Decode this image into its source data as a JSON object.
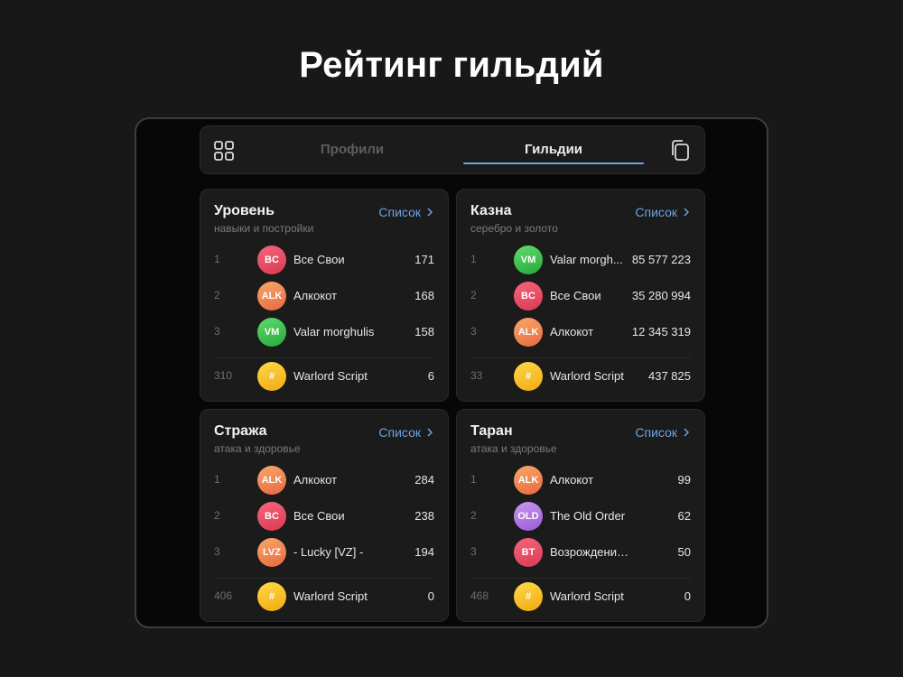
{
  "page": {
    "title": "Рейтинг гильдий"
  },
  "tabs": [
    {
      "label": "Профили",
      "active": false
    },
    {
      "label": "Гильдии",
      "active": true
    }
  ],
  "icons": {
    "menu": "grid-icon",
    "copy": "copy-icon",
    "chevron": "chevron-right-icon"
  },
  "colors": {
    "accent": "#6ea3e0"
  },
  "cards": [
    {
      "title": "Уровень",
      "subtitle": "навыки и постройки",
      "link": "Список",
      "rows": [
        {
          "rank": "1",
          "avatar": "BC",
          "name": "Все Свои",
          "value": "171"
        },
        {
          "rank": "2",
          "avatar": "ALK",
          "name": "Алкокот",
          "value": "168"
        },
        {
          "rank": "3",
          "avatar": "VM",
          "name": "Valar morghulis",
          "value": "158"
        }
      ],
      "own": {
        "rank": "310",
        "avatar": "#",
        "name": "Warlord Script",
        "value": "6"
      }
    },
    {
      "title": "Казна",
      "subtitle": "серебро и золото",
      "link": "Список",
      "rows": [
        {
          "rank": "1",
          "avatar": "VM",
          "name": "Valar morgh...",
          "value": "85 577 223"
        },
        {
          "rank": "2",
          "avatar": "BC",
          "name": "Все Свои",
          "value": "35 280 994"
        },
        {
          "rank": "3",
          "avatar": "ALK",
          "name": "Алкокот",
          "value": "12 345 319"
        }
      ],
      "own": {
        "rank": "33",
        "avatar": "#",
        "name": "Warlord Script",
        "value": "437 825"
      }
    },
    {
      "title": "Стража",
      "subtitle": "атака и здоровье",
      "link": "Список",
      "rows": [
        {
          "rank": "1",
          "avatar": "ALK",
          "name": "Алкокот",
          "value": "284"
        },
        {
          "rank": "2",
          "avatar": "BC",
          "name": "Все Свои",
          "value": "238"
        },
        {
          "rank": "3",
          "avatar": "LVZ",
          "name": "- Lucky [VZ] -",
          "value": "194"
        }
      ],
      "own": {
        "rank": "406",
        "avatar": "#",
        "name": "Warlord Script",
        "value": "0"
      }
    },
    {
      "title": "Таран",
      "subtitle": "атака и здоровье",
      "link": "Список",
      "rows": [
        {
          "rank": "1",
          "avatar": "ALK",
          "name": "Алкокот",
          "value": "99"
        },
        {
          "rank": "2",
          "avatar": "OLD",
          "name": "The Old Order",
          "value": "62"
        },
        {
          "rank": "3",
          "avatar": "BT",
          "name": "Возрождение тьмы",
          "value": "50"
        }
      ],
      "own": {
        "rank": "468",
        "avatar": "#",
        "name": "Warlord Script",
        "value": "0"
      }
    }
  ],
  "avatar_colors": {
    "BC": [
      "#f6667c",
      "#d93a52"
    ],
    "ALK": [
      "#f8a86a",
      "#e8683f"
    ],
    "VM": [
      "#5fdc6e",
      "#26a83a"
    ],
    "LVZ": [
      "#f8a86a",
      "#e8683f"
    ],
    "OLD": [
      "#c89af0",
      "#9a5ad8"
    ],
    "BT": [
      "#f6667c",
      "#d93a52"
    ],
    "#": [
      "#ffd84a",
      "#f2aa10"
    ]
  }
}
